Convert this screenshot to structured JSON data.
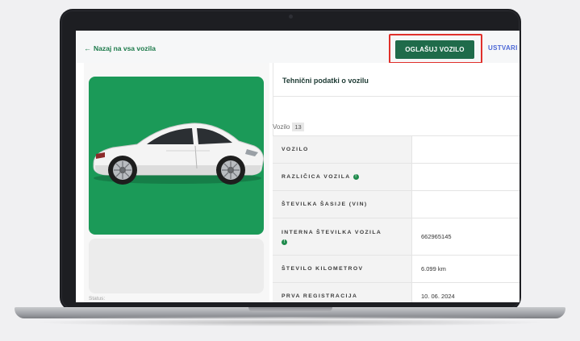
{
  "topbar": {
    "back_label": "Nazaj na vsa vozila",
    "primary_button": "OGLAŠUJ VOZILO",
    "secondary_button": "USTVARI"
  },
  "panel": {
    "title": "Tehnični podatki o vozilu",
    "vozilo_label": "Vozilo",
    "vozilo_count": "13"
  },
  "specs": [
    {
      "key": "VOZILO",
      "value": "",
      "info": false
    },
    {
      "key": "RAZLIČICA VOZILA",
      "value": "",
      "info": true
    },
    {
      "key": "ŠTEVILKA ŠASIJE (VIN)",
      "value": "",
      "info": false
    },
    {
      "key": "INTERNA ŠTEVILKA VOZILA",
      "value": "662965145",
      "info": true
    },
    {
      "key": "ŠTEVILO KILOMETROV",
      "value": "6.099 km",
      "info": false
    },
    {
      "key": "PRVA REGISTRACIJA",
      "value": "10. 06. 2024",
      "info": false
    }
  ],
  "status_label": "Status:",
  "colors": {
    "brand_green": "#1f6b4a",
    "car_card_green": "#1b9a58",
    "highlight_red": "#e0302b",
    "link_blue": "#4b67d6"
  }
}
